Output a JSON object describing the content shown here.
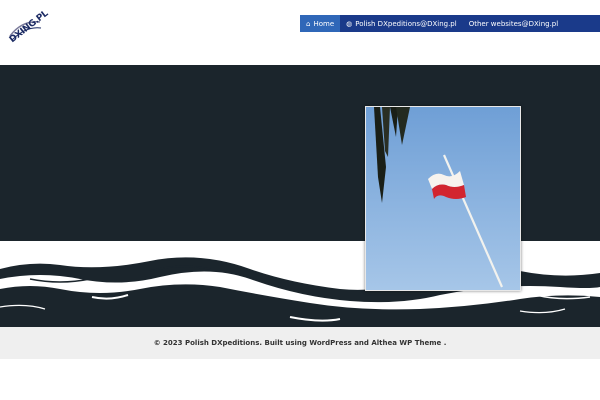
{
  "logo": {
    "text": "DXING.PL"
  },
  "nav": {
    "items": [
      {
        "label": "Home",
        "icon": "home-icon",
        "active": true
      },
      {
        "label": "Polish DXpeditions@DXing.pl",
        "icon": "globe-icon",
        "active": false
      },
      {
        "label": "Other websites@DXing.pl",
        "icon": "",
        "active": false
      }
    ]
  },
  "colors": {
    "nav_bg": "#1a3a8a",
    "nav_active": "#2f67b8",
    "hero_bg": "#1b252c",
    "footer_bg": "#efefef"
  },
  "footer": {
    "text": "© 2023 Polish DXpeditions. Built using WordPress and Althea WP Theme ."
  }
}
